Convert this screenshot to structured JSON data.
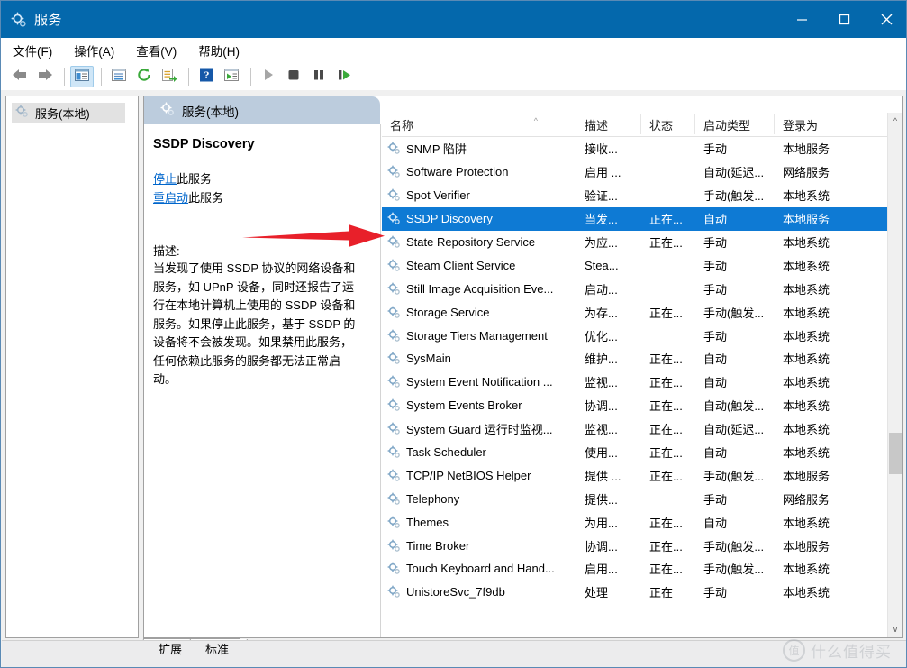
{
  "window": {
    "title": "服务",
    "icon": "services-gear-icon",
    "minimize_label": "最小化",
    "maximize_label": "最大化",
    "close_label": "关闭",
    "accent_color": "#0468ac",
    "selection_color": "#0e7ad4"
  },
  "menu": {
    "items": [
      {
        "label": "文件(F)"
      },
      {
        "label": "操作(A)"
      },
      {
        "label": "查看(V)"
      },
      {
        "label": "帮助(H)"
      }
    ]
  },
  "toolbar": {
    "buttons": [
      {
        "name": "back",
        "icon": "arrow-left-icon"
      },
      {
        "name": "forward",
        "icon": "arrow-right-icon"
      },
      {
        "name": "show-hide-console-tree",
        "icon": "console-tree-icon",
        "active": true
      },
      {
        "name": "properties",
        "icon": "properties-icon"
      },
      {
        "name": "refresh",
        "icon": "refresh-icon"
      },
      {
        "name": "export-list",
        "icon": "export-list-icon"
      },
      {
        "name": "help",
        "icon": "help-icon"
      },
      {
        "name": "show-action-pane",
        "icon": "action-pane-icon"
      },
      {
        "name": "start-service",
        "icon": "play-icon"
      },
      {
        "name": "stop-service",
        "icon": "stop-icon"
      },
      {
        "name": "pause-service",
        "icon": "pause-icon"
      },
      {
        "name": "restart-service",
        "icon": "restart-icon"
      }
    ]
  },
  "sidebar": {
    "items": [
      {
        "label": "服务(本地)",
        "icon": "services-gear-icon",
        "selected": true
      }
    ]
  },
  "pane": {
    "header": "服务(本地)",
    "header_icon": "services-gear-icon"
  },
  "detail": {
    "title": "SSDP Discovery",
    "links": [
      {
        "link_text": "停止",
        "suffix": "此服务"
      },
      {
        "link_text": "重启动",
        "suffix": "此服务"
      }
    ],
    "description_label": "描述:",
    "description": "当发现了使用 SSDP 协议的网络设备和服务，如 UPnP 设备，同时还报告了运行在本地计算机上使用的 SSDP 设备和服务。如果停止此服务，基于 SSDP 的设备将不会被发现。如果禁用此服务，任何依赖此服务的服务都无法正常启动。"
  },
  "list": {
    "columns": [
      {
        "key": "name",
        "label": "名称",
        "sorted": true
      },
      {
        "key": "desc",
        "label": "描述"
      },
      {
        "key": "status",
        "label": "状态"
      },
      {
        "key": "start",
        "label": "启动类型"
      },
      {
        "key": "logon",
        "label": "登录为"
      }
    ],
    "rows": [
      {
        "name": "SNMP 陷阱",
        "desc": "接收...",
        "status": "",
        "start": "手动",
        "logon": "本地服务"
      },
      {
        "name": "Software Protection",
        "desc": "启用 ...",
        "status": "",
        "start": "自动(延迟...",
        "logon": "网络服务"
      },
      {
        "name": "Spot Verifier",
        "desc": "验证...",
        "status": "",
        "start": "手动(触发...",
        "logon": "本地系统"
      },
      {
        "name": "SSDP Discovery",
        "desc": "当发...",
        "status": "正在...",
        "start": "自动",
        "logon": "本地服务",
        "selected": true
      },
      {
        "name": "State Repository Service",
        "desc": "为应...",
        "status": "正在...",
        "start": "手动",
        "logon": "本地系统"
      },
      {
        "name": "Steam Client Service",
        "desc": "Stea...",
        "status": "",
        "start": "手动",
        "logon": "本地系统"
      },
      {
        "name": "Still Image Acquisition Eve...",
        "desc": "启动...",
        "status": "",
        "start": "手动",
        "logon": "本地系统"
      },
      {
        "name": "Storage Service",
        "desc": "为存...",
        "status": "正在...",
        "start": "手动(触发...",
        "logon": "本地系统"
      },
      {
        "name": "Storage Tiers Management",
        "desc": "优化...",
        "status": "",
        "start": "手动",
        "logon": "本地系统"
      },
      {
        "name": "SysMain",
        "desc": "维护...",
        "status": "正在...",
        "start": "自动",
        "logon": "本地系统"
      },
      {
        "name": "System Event Notification ...",
        "desc": "监视...",
        "status": "正在...",
        "start": "自动",
        "logon": "本地系统"
      },
      {
        "name": "System Events Broker",
        "desc": "协调...",
        "status": "正在...",
        "start": "自动(触发...",
        "logon": "本地系统"
      },
      {
        "name": "System Guard 运行时监视...",
        "desc": "监视...",
        "status": "正在...",
        "start": "自动(延迟...",
        "logon": "本地系统"
      },
      {
        "name": "Task Scheduler",
        "desc": "使用...",
        "status": "正在...",
        "start": "自动",
        "logon": "本地系统"
      },
      {
        "name": "TCP/IP NetBIOS Helper",
        "desc": "提供 ...",
        "status": "正在...",
        "start": "手动(触发...",
        "logon": "本地服务"
      },
      {
        "name": "Telephony",
        "desc": "提供...",
        "status": "",
        "start": "手动",
        "logon": "网络服务"
      },
      {
        "name": "Themes",
        "desc": "为用...",
        "status": "正在...",
        "start": "自动",
        "logon": "本地系统"
      },
      {
        "name": "Time Broker",
        "desc": "协调...",
        "status": "正在...",
        "start": "手动(触发...",
        "logon": "本地服务"
      },
      {
        "name": "Touch Keyboard and Hand...",
        "desc": "启用...",
        "status": "正在...",
        "start": "手动(触发...",
        "logon": "本地系统"
      },
      {
        "name": "UnistoreSvc_7f9db",
        "desc": "处理",
        "status": "正在",
        "start": "手动",
        "logon": "本地系统"
      }
    ]
  },
  "tabs": [
    {
      "label": "扩展",
      "active": false
    },
    {
      "label": "标准",
      "active": true
    }
  ],
  "watermark": {
    "badge": "值",
    "text": "什么值得买"
  },
  "annotation": {
    "arrow": "red-arrow-pointing-right",
    "color": "#e8202a",
    "target": "SSDP Discovery"
  }
}
